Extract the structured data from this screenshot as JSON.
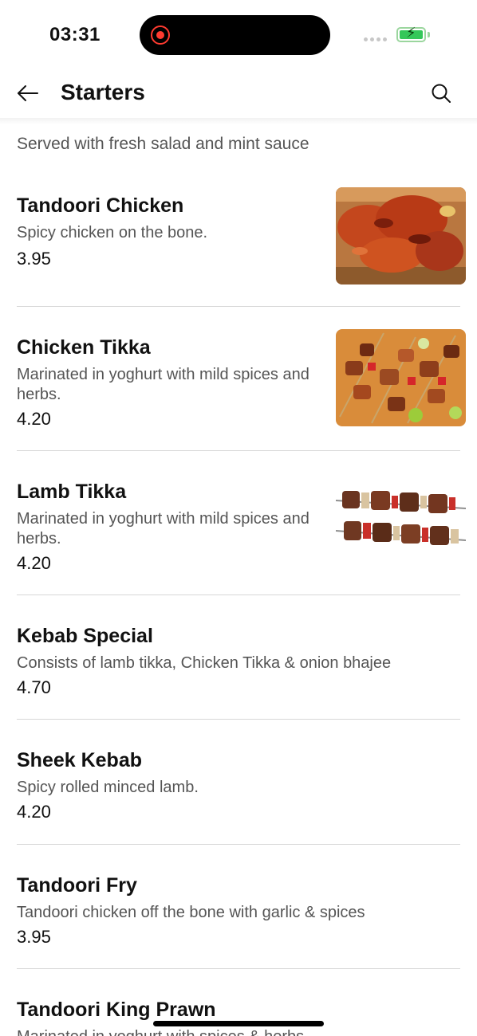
{
  "status_bar": {
    "time": "03:31",
    "battery_color": "#34c759",
    "recording_color": "#ff3b30"
  },
  "header": {
    "title": "Starters",
    "back_icon": "arrow-left-icon",
    "search_icon": "search-icon"
  },
  "section": {
    "subtitle": "Served with fresh salad and mint sauce"
  },
  "items": [
    {
      "name": "Tandoori Chicken",
      "description": "Spicy chicken on the bone.",
      "price": "3.95",
      "image": "tandoori-chicken-photo"
    },
    {
      "name": "Chicken Tikka",
      "description": "Marinated in yoghurt with mild spices and herbs.",
      "price": "4.20",
      "image": "chicken-tikka-photo"
    },
    {
      "name": "Lamb Tikka",
      "description": "Marinated in yoghurt with mild spices and herbs.",
      "price": "4.20",
      "image": "lamb-tikka-photo"
    },
    {
      "name": "Kebab Special",
      "description": "Consists of lamb tikka, Chicken Tikka & onion bhajee",
      "price": "4.70"
    },
    {
      "name": "Sheek Kebab",
      "description": "Spicy rolled minced lamb.",
      "price": "4.20"
    },
    {
      "name": "Tandoori Fry",
      "description": "Tandoori chicken off the bone with garlic & spices",
      "price": "3.95"
    },
    {
      "name": "Tandoori King Prawn",
      "description": "Marinated in yoghurt with spices & herbs"
    }
  ]
}
